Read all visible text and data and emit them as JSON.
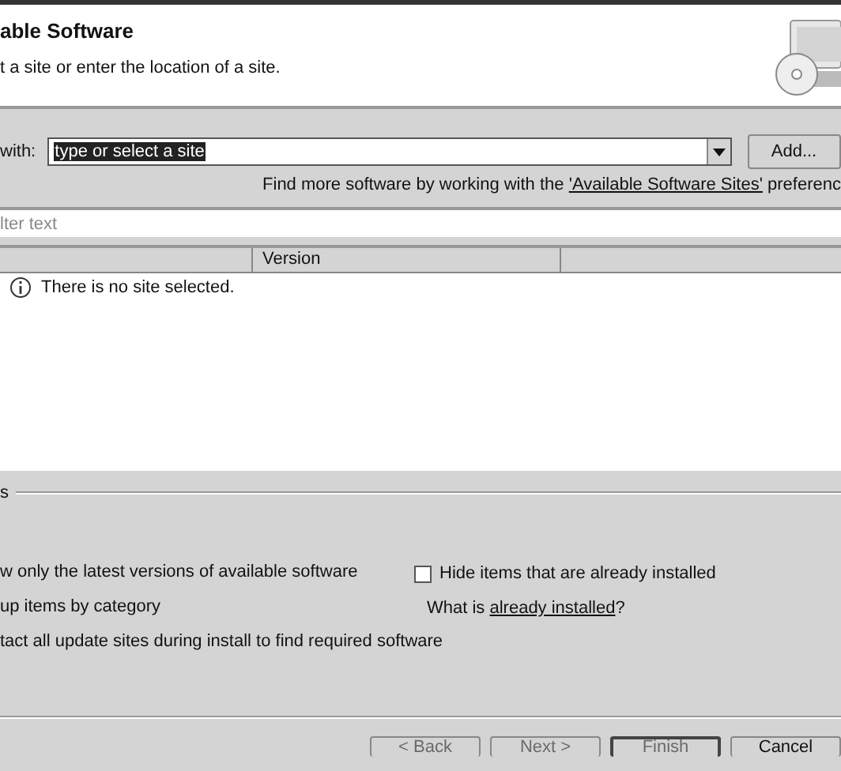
{
  "header": {
    "title": "able Software",
    "subtitle": "t a site or enter the location of a site."
  },
  "work_with": {
    "label": "with:",
    "value": "type or select a site",
    "add_button": "Add..."
  },
  "find_more": {
    "text": "Find more software by working with the ",
    "link": "'Available Software Sites'",
    "after": " preferenc"
  },
  "filter": {
    "placeholder": "lter text"
  },
  "table": {
    "columns": [
      "Version"
    ],
    "message": "There is no site selected."
  },
  "details": {
    "label": "s"
  },
  "options": [
    {
      "label": "w only the latest versions of available software"
    },
    {
      "label": "up items by category"
    },
    {
      "label": "tact all update sites during install to find required software"
    }
  ],
  "hide_installed": {
    "label": "Hide items that are already installed",
    "checked": false
  },
  "already_installed": {
    "before": "What is ",
    "link": "already installed",
    "after": "?"
  },
  "buttons": [
    {
      "label": "< Back",
      "disabled": true,
      "default": false
    },
    {
      "label": "Next >",
      "disabled": true,
      "default": false
    },
    {
      "label": "Finish",
      "disabled": true,
      "default": true
    },
    {
      "label": "Cancel",
      "disabled": false,
      "default": false
    }
  ]
}
